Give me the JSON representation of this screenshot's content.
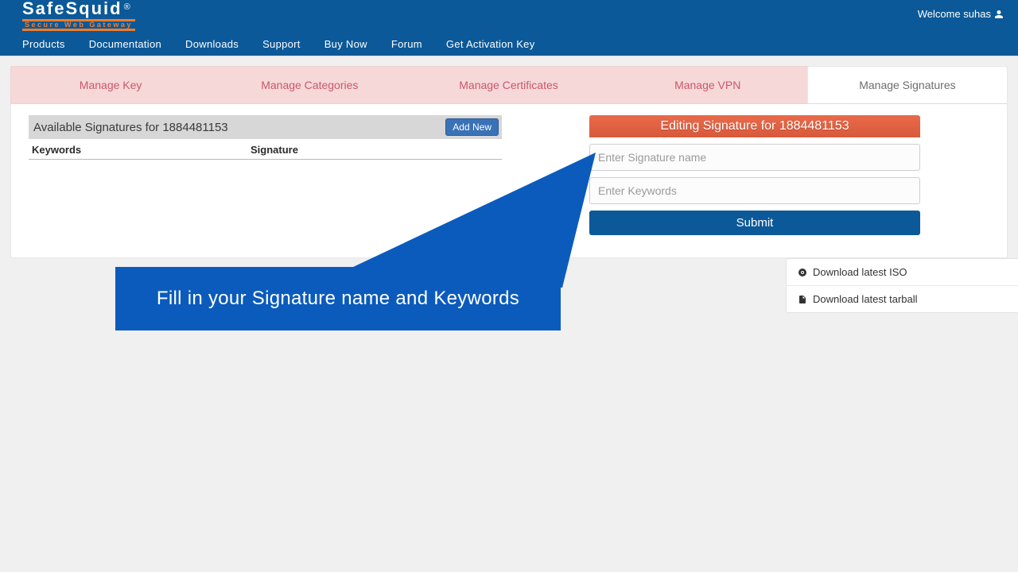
{
  "header": {
    "brand_main": "SafeSquid",
    "brand_r": "®",
    "brand_sub": "Secure Web Gateway",
    "welcome": "Welcome suhas"
  },
  "nav": {
    "items": [
      "Products",
      "Documentation",
      "Downloads",
      "Support",
      "Buy Now",
      "Forum",
      "Get Activation Key"
    ]
  },
  "tabs": {
    "items": [
      "Manage Key",
      "Manage Categories",
      "Manage Certificates",
      "Manage VPN",
      "Manage Signatures"
    ],
    "active_index": 4
  },
  "left": {
    "available_title": "Available Signatures for 1884481153",
    "add_new": "Add New",
    "col_keywords": "Keywords",
    "col_signature": "Signature"
  },
  "right": {
    "editing_title": "Editing Signature for 1884481153",
    "placeholder_name": "Enter Signature name",
    "placeholder_keywords": "Enter Keywords",
    "submit": "Submit"
  },
  "downloads": {
    "iso": "Download latest ISO",
    "tarball": "Download latest tarball"
  },
  "callout": {
    "text": "Fill in your Signature name and Keywords"
  }
}
